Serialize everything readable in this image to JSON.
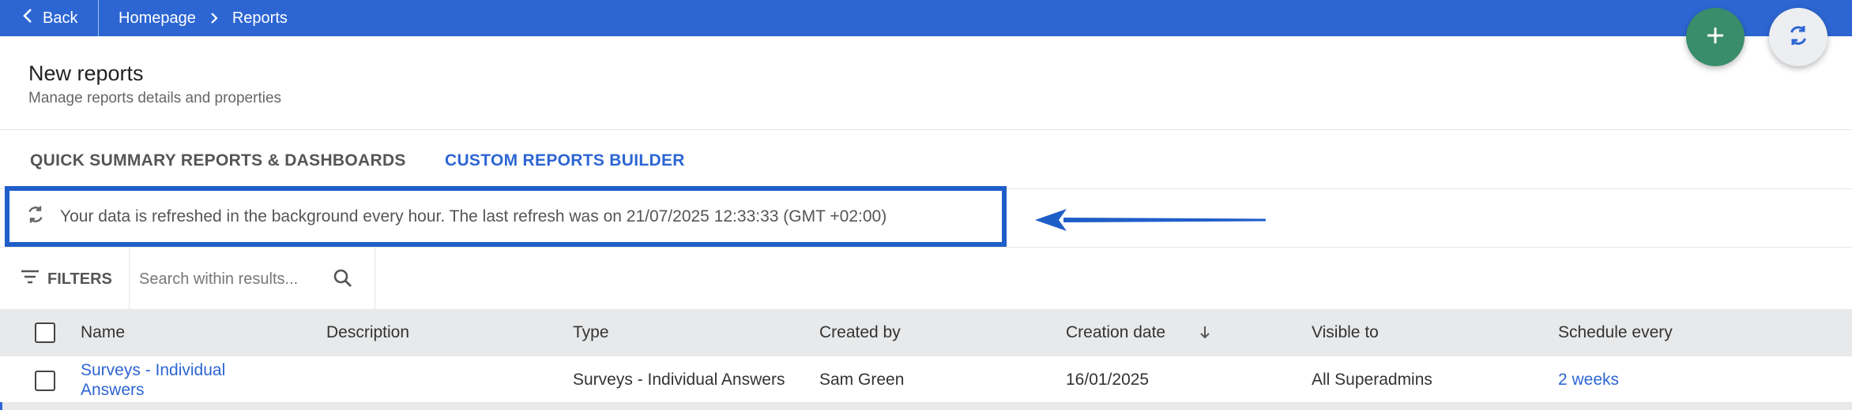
{
  "topbar": {
    "back_label": "Back",
    "breadcrumb": [
      "Homepage",
      "Reports"
    ]
  },
  "header": {
    "title": "New reports",
    "subtitle": "Manage reports details and properties"
  },
  "tabs": [
    {
      "label": "QUICK SUMMARY REPORTS & DASHBOARDS",
      "active": false
    },
    {
      "label": "CUSTOM REPORTS BUILDER",
      "active": true
    }
  ],
  "info_banner": {
    "text": "Your data is refreshed in the background every hour. The last refresh was on 21/07/2025 12:33:33 (GMT +02:00)",
    "icon": "refresh-icon"
  },
  "filters": {
    "label": "FILTERS",
    "search_placeholder": "Search within results..."
  },
  "table": {
    "columns": [
      "Name",
      "Description",
      "Type",
      "Created by",
      "Creation date",
      "Visible to",
      "Schedule every"
    ],
    "sorted_by": "Creation date",
    "rows": [
      {
        "name_line1": "Surveys - Individual",
        "name_line2": "Answers",
        "description": "",
        "type": "Surveys - Individual Answers",
        "created_by": "Sam Green",
        "creation_date": "16/01/2025",
        "visible_to": "All Superadmins",
        "schedule_every": "2 weeks"
      }
    ]
  },
  "colors": {
    "topbar": "#2d66d3",
    "accent": "#2d66d3",
    "add_fab": "#3a8d6a",
    "highlight_border": "#1f5ec9"
  }
}
